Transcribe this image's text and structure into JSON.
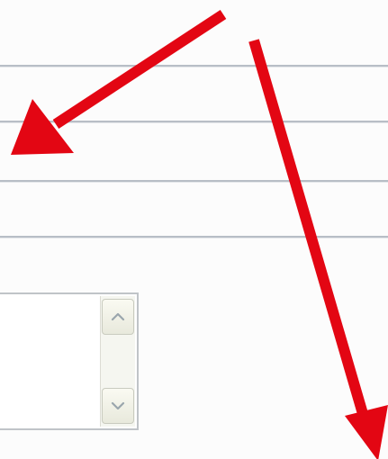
{
  "form": {
    "separator_count": 4,
    "textarea": {
      "value": "",
      "scroll_up_icon": "chevron-up-icon",
      "scroll_down_icon": "chevron-down-icon"
    }
  },
  "annotations": {
    "arrow_color": "#e30613",
    "arrows": [
      "arrow-pointing-left-down",
      "arrow-pointing-down-right"
    ]
  },
  "colors": {
    "background": "#fcfcfc",
    "separator": "#b8bec6",
    "scroll_button": "#eeeee4",
    "chevron": "#9aa6ad"
  }
}
